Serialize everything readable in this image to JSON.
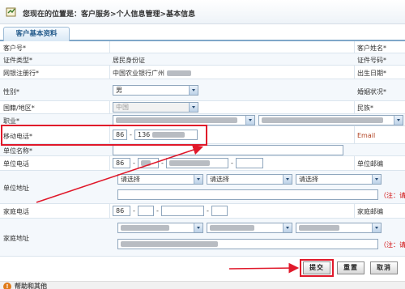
{
  "breadcrumb": "您现在的位置是：客户服务>个人信息管理>基本信息",
  "tab_label": "客户基本资料",
  "fields": {
    "customer_no": "客户号*",
    "customer_name": "客户姓名*",
    "id_type": "证件类型*",
    "id_type_value": "居民身份证",
    "id_no": "证件号码*",
    "reg_bank": "网银注册行*",
    "reg_bank_value": "中国农业银行广州",
    "birth_date": "出生日期*",
    "gender": "性别*",
    "gender_value": "男",
    "marital": "婚姻状况*",
    "nationality": "国籍/地区*",
    "nationality_value": "中国",
    "ethnicity": "民族*",
    "occupation": "职业*",
    "mobile": "移动电话*",
    "mobile_cc": "86",
    "mobile_prefix": "136",
    "email": "Email",
    "company": "单位名称*",
    "work_phone": "单位电话",
    "work_phone_cc": "86",
    "work_post": "单位邮编",
    "work_addr": "单位地址",
    "select_placeholder": "请选择",
    "note": "（注：请",
    "home_phone": "家庭电话",
    "home_phone_cc": "86",
    "home_post": "家庭邮编",
    "home_addr": "家庭地址"
  },
  "buttons": {
    "submit": "提交",
    "reset": "重置",
    "cancel": "取消"
  },
  "help_title": "帮助和其他",
  "colors": {
    "highlight": "#e0182a",
    "tab_text": "#235a8a",
    "note": "#d00000"
  }
}
